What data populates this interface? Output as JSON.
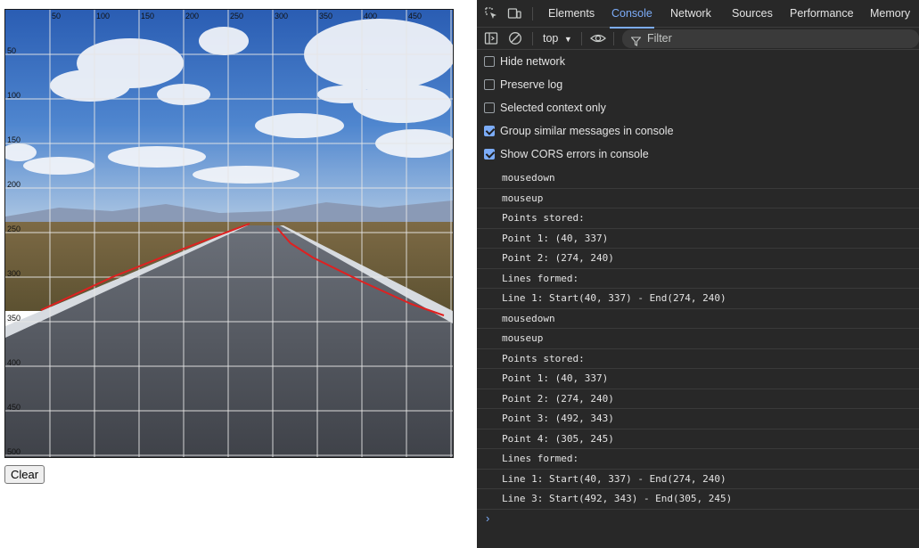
{
  "canvas": {
    "tick_labels_x": [
      "50",
      "100",
      "150",
      "200",
      "250",
      "300",
      "350",
      "400",
      "450"
    ],
    "tick_labels_y": [
      "50",
      "100",
      "150",
      "200",
      "250",
      "300",
      "350",
      "400",
      "450",
      "500"
    ],
    "grid_step": 50,
    "grid_color": "#e6e6e6",
    "line_color": "#e02020",
    "sky_color": "#2f64b8",
    "road_color": "#55595f"
  },
  "clear_button": {
    "label": "Clear"
  },
  "devtools": {
    "tabs": [
      {
        "label": "Elements",
        "active": false
      },
      {
        "label": "Console",
        "active": true
      },
      {
        "label": "Network",
        "active": false
      },
      {
        "label": "Sources",
        "active": false
      },
      {
        "label": "Performance",
        "active": false
      },
      {
        "label": "Memory",
        "active": false
      }
    ],
    "context": "top",
    "filter_placeholder": "Filter",
    "settings": [
      {
        "label": "Hide network",
        "checked": false
      },
      {
        "label": "Preserve log",
        "checked": false
      },
      {
        "label": "Selected context only",
        "checked": false
      },
      {
        "label": "Group similar messages in console",
        "checked": true
      },
      {
        "label": "Show CORS errors in console",
        "checked": true
      }
    ],
    "logs": [
      "mousedown",
      "mouseup",
      "Points stored:",
      "Point 1: (40, 337)",
      "Point 2: (274, 240)",
      "Lines formed:",
      "Line 1: Start(40, 337) - End(274, 240)",
      "mousedown",
      "mouseup",
      "Points stored:",
      "Point 1: (40, 337)",
      "Point 2: (274, 240)",
      "Point 3: (492, 343)",
      "Point 4: (305, 245)",
      "Lines formed:",
      "Line 1: Start(40, 337) - End(274, 240)",
      "Line 3: Start(492, 343) - End(305, 245)"
    ],
    "prompt_symbol": "›",
    "accent_color": "#7cacf8"
  }
}
